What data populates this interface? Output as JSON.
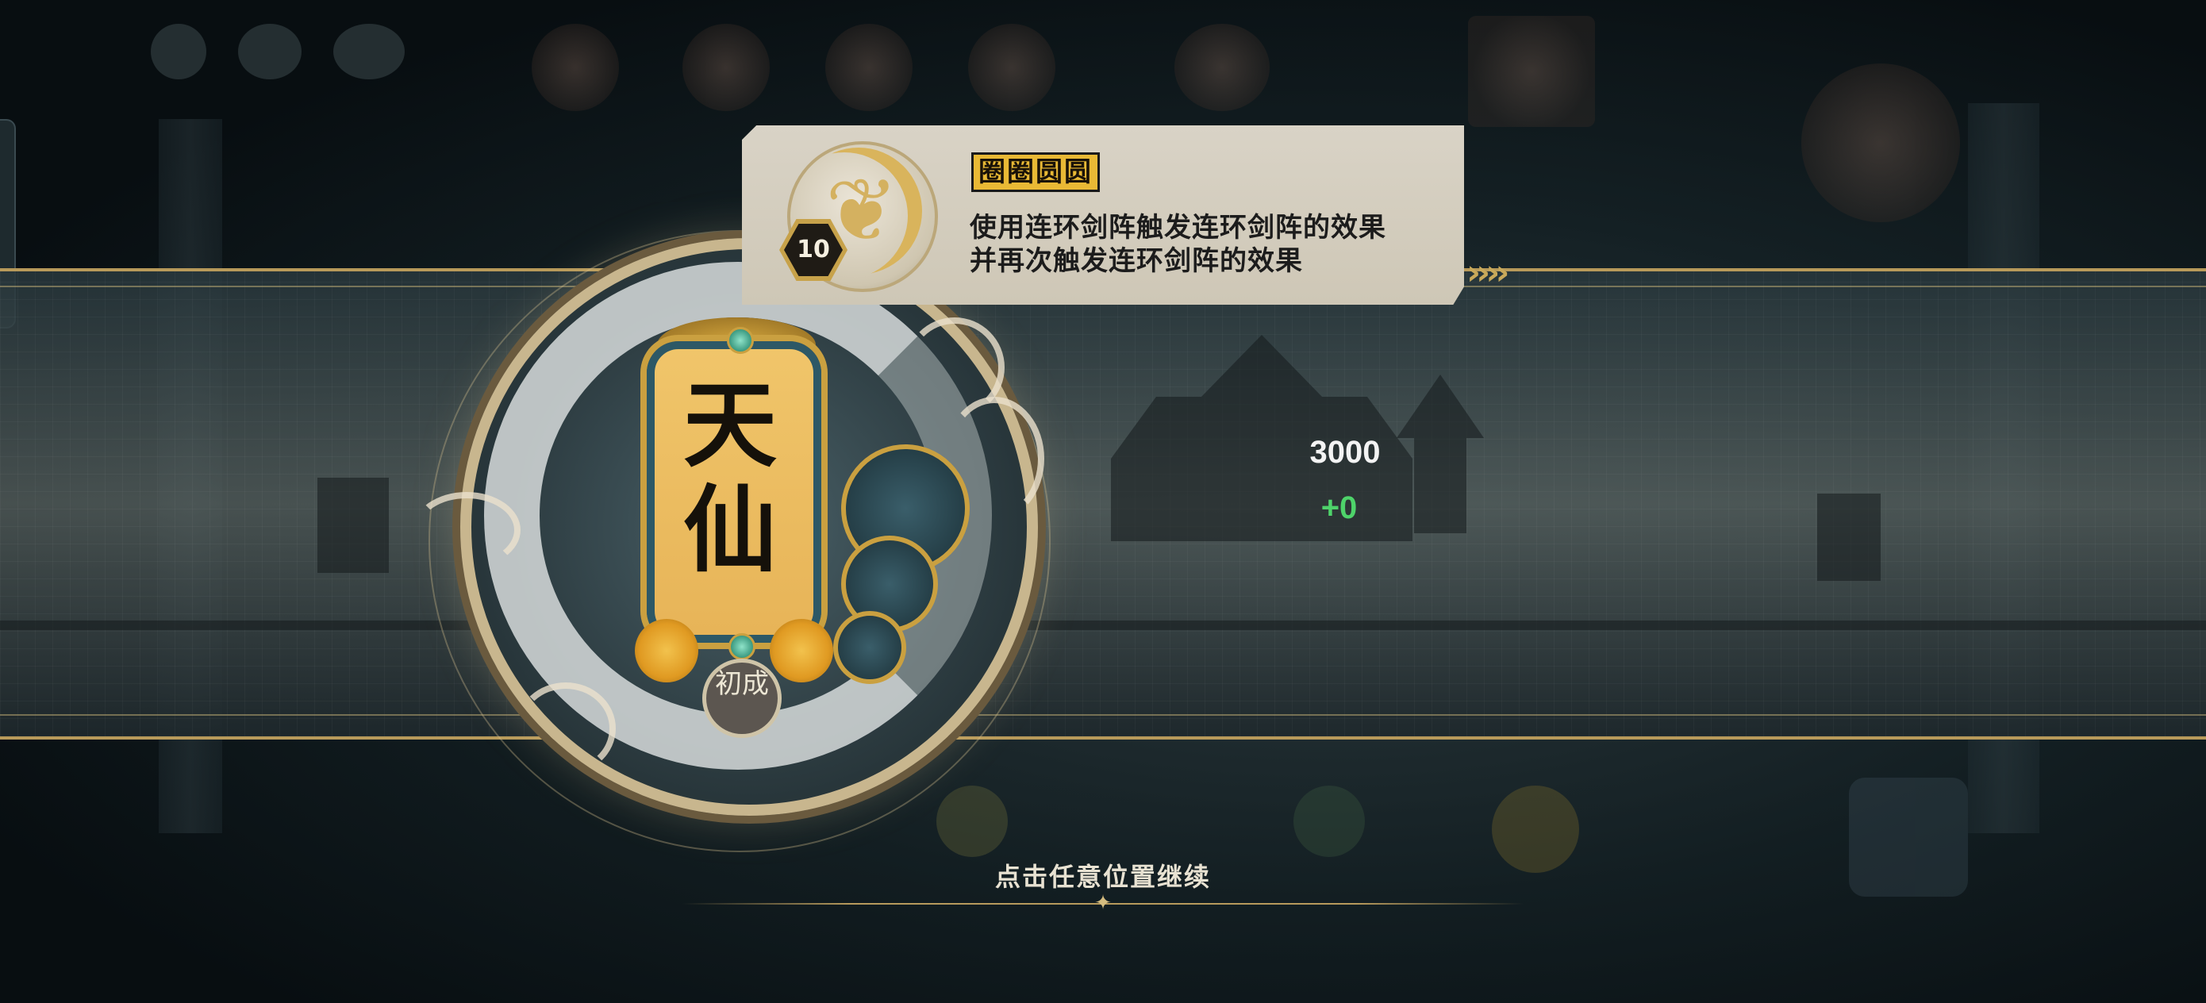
{
  "skill": {
    "name": "圈圈圆圆",
    "level": "10",
    "description_line1": "使用连环剑阵触发连环剑阵的效果",
    "description_line2": "并再次触发连环剑阵的效果"
  },
  "emblem": {
    "title": "天仙",
    "rank": "初成"
  },
  "stats": {
    "value": "3000",
    "delta": "+0"
  },
  "prompt": {
    "continue": "点击任意位置继续"
  },
  "colors": {
    "gold": "#c9a95a",
    "delta_green": "#4ed36a",
    "tooltip_bg": "#d9d3c6",
    "name_highlight": "#e9b935"
  }
}
